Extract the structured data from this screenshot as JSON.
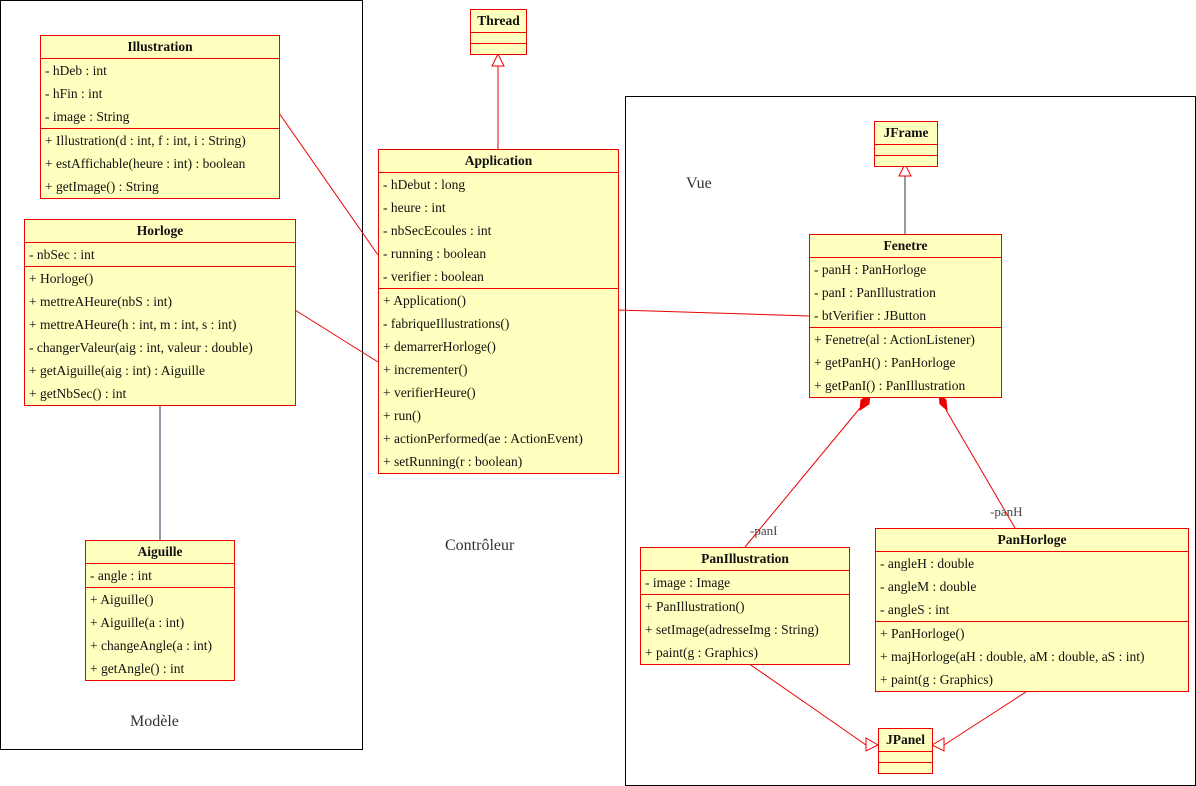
{
  "packages": {
    "model": "Modèle",
    "controller": "Contrôleur",
    "view": "Vue"
  },
  "classes": [
    {
      "id": "illustration",
      "name": "Illustration",
      "attributes": [
        "- hDeb : int",
        "- hFin : int",
        "- image : String"
      ],
      "operations": [
        "+ Illustration(d : int, f : int, i : String)",
        "+ estAffichable(heure : int) : boolean",
        "+ getImage() : String"
      ]
    },
    {
      "id": "horloge",
      "name": "Horloge",
      "attributes": [
        "- nbSec : int"
      ],
      "operations": [
        "+ Horloge()",
        "+ mettreAHeure(nbS : int)",
        "+ mettreAHeure(h : int, m : int, s : int)",
        "- changerValeur(aig : int, valeur : double)",
        "+ getAiguille(aig : int) : Aiguille",
        "+ getNbSec() : int"
      ]
    },
    {
      "id": "aiguille",
      "name": "Aiguille",
      "attributes": [
        "- angle : int"
      ],
      "operations": [
        "+ Aiguille()",
        "+ Aiguille(a : int)",
        "+ changeAngle(a : int)",
        "+ getAngle() : int"
      ]
    },
    {
      "id": "thread",
      "name": "Thread",
      "attributes": [],
      "operations": []
    },
    {
      "id": "application",
      "name": "Application",
      "attributes": [
        "- hDebut : long",
        "- heure : int",
        "- nbSecEcoules : int",
        "- running : boolean",
        "- verifier : boolean"
      ],
      "operations": [
        "+ Application()",
        "- fabriqueIllustrations()",
        "+ demarrerHorloge()",
        "+ incrementer()",
        "+ verifierHeure()",
        "+ run()",
        "+ actionPerformed(ae : ActionEvent)",
        "+ setRunning(r : boolean)"
      ]
    },
    {
      "id": "jframe",
      "name": "JFrame",
      "attributes": [],
      "operations": []
    },
    {
      "id": "fenetre",
      "name": "Fenetre",
      "attributes": [
        "- panH : PanHorloge",
        "- panI : PanIllustration",
        "- btVerifier : JButton"
      ],
      "operations": [
        "+ Fenetre(al : ActionListener)",
        "+ getPanH() : PanHorloge",
        "+ getPanI() : PanIllustration"
      ]
    },
    {
      "id": "panillustration",
      "name": "PanIllustration",
      "attributes": [
        "- image : Image"
      ],
      "operations": [
        "+ PanIllustration()",
        "+ setImage(adresseImg : String)",
        "+ paint(g : Graphics)"
      ]
    },
    {
      "id": "panhorloge",
      "name": "PanHorloge",
      "attributes": [
        "- angleH : double",
        "- angleM : double",
        "- angleS : int"
      ],
      "operations": [
        "+ PanHorloge()",
        "+ majHorloge(aH : double, aM : double, aS : int)",
        "+ paint(g : Graphics)"
      ]
    },
    {
      "id": "jpanel",
      "name": "JPanel",
      "attributes": [],
      "operations": []
    }
  ],
  "roles": {
    "panI": "-panI",
    "panH": "-panH"
  },
  "colors": {
    "class_fill": "#ffffc0",
    "class_border": "#ee0000",
    "line": "#ee0000",
    "package_border": "#000000"
  }
}
